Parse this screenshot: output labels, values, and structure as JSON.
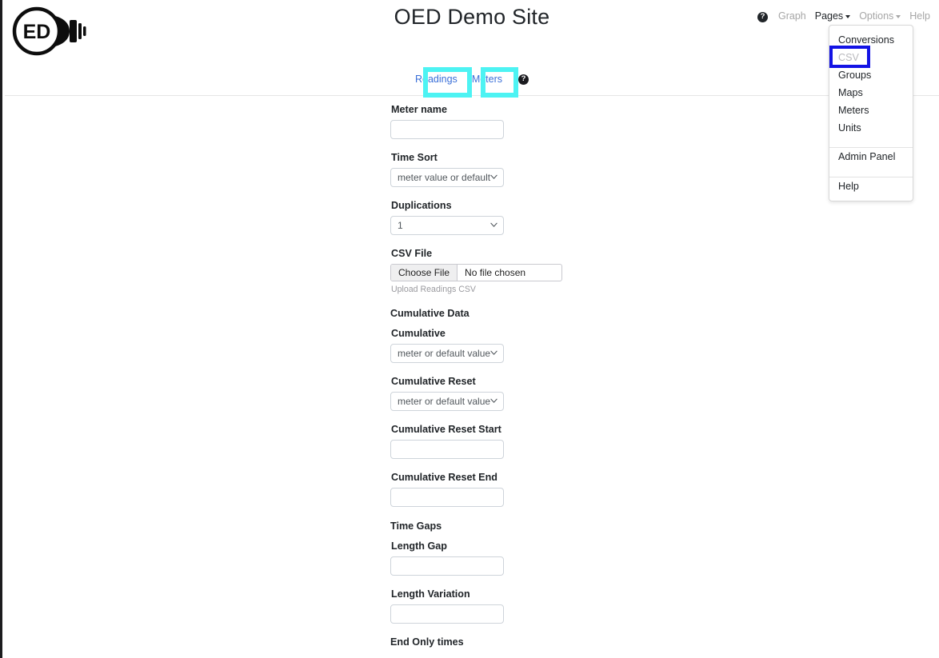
{
  "site": {
    "title": "OED Demo Site",
    "logo_text": "ED"
  },
  "topnav": {
    "help_icon": "question-circle-icon",
    "items": [
      {
        "label": "Graph",
        "caret": false,
        "muted": true
      },
      {
        "label": "Pages",
        "caret": true,
        "muted": false
      },
      {
        "label": "Options",
        "caret": true,
        "muted": true
      },
      {
        "label": "Help",
        "caret": false,
        "muted": true
      }
    ]
  },
  "pages_dropdown": {
    "open": true,
    "group1": [
      {
        "label": "Conversions",
        "muted": false
      },
      {
        "label": "CSV",
        "muted": true,
        "highlighted": true
      },
      {
        "label": "Groups",
        "muted": false
      },
      {
        "label": "Maps",
        "muted": false
      },
      {
        "label": "Meters",
        "muted": false
      },
      {
        "label": "Units",
        "muted": false
      }
    ],
    "group2": [
      {
        "label": "Admin Panel",
        "muted": false
      }
    ],
    "group3": [
      {
        "label": "Help",
        "muted": false
      }
    ]
  },
  "highlights": {
    "blue": "#1313e5",
    "cyan": "#4df3f3"
  },
  "tabs": {
    "items": [
      {
        "label": "Readings",
        "highlighted": true
      },
      {
        "label": "Meters",
        "highlighted": true
      }
    ],
    "help_icon": "question-circle-icon"
  },
  "form": {
    "meter_name": {
      "label": "Meter name",
      "value": "",
      "placeholder": ""
    },
    "time_sort": {
      "label": "Time Sort",
      "value": "meter value or default"
    },
    "duplications": {
      "label": "Duplications",
      "value": "1"
    },
    "csv_file": {
      "label": "CSV File",
      "button": "Choose File",
      "file_status": "No file chosen",
      "help": "Upload Readings CSV"
    },
    "cumulative_data_heading": "Cumulative Data",
    "cumulative": {
      "label": "Cumulative",
      "value": "meter or default value"
    },
    "cumulative_reset": {
      "label": "Cumulative Reset",
      "value": "meter or default value"
    },
    "cumulative_reset_start": {
      "label": "Cumulative Reset Start",
      "value": ""
    },
    "cumulative_reset_end": {
      "label": "Cumulative Reset End",
      "value": ""
    },
    "time_gaps_heading": "Time Gaps",
    "length_gap": {
      "label": "Length Gap",
      "value": ""
    },
    "length_variation": {
      "label": "Length Variation",
      "value": ""
    },
    "end_only_times_heading": "End Only times"
  }
}
